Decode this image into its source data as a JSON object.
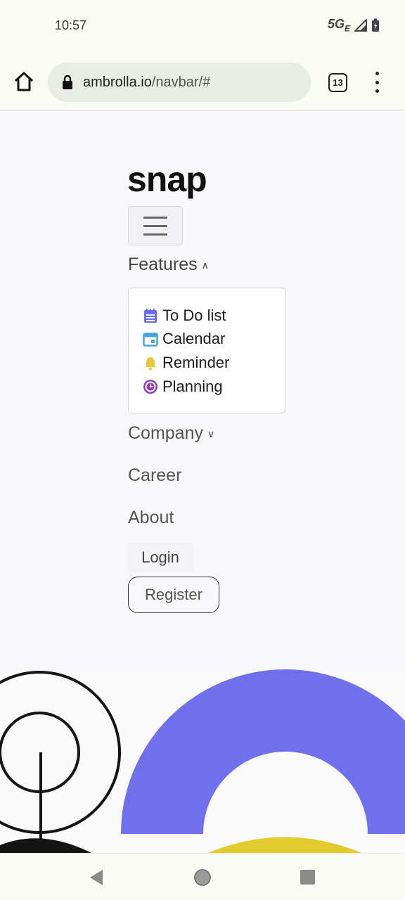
{
  "status_bar": {
    "time": "10:57",
    "network": "5G",
    "network_sub": "E"
  },
  "browser": {
    "url_domain": "ambrolla.io",
    "url_path": "/navbar/#",
    "tab_count": "13"
  },
  "page": {
    "logo": "snap",
    "nav": {
      "features": "Features",
      "features_items": [
        {
          "label": "To Do list",
          "icon": "todo-list-icon",
          "color": "#6c6ee8"
        },
        {
          "label": "Calendar",
          "icon": "calendar-icon",
          "color": "#4aa3d8"
        },
        {
          "label": "Reminder",
          "icon": "bell-icon",
          "color": "#e8c93a"
        },
        {
          "label": "Planning",
          "icon": "clock-icon",
          "color": "#8b3fb3"
        }
      ],
      "company": "Company",
      "career": "Career",
      "about": "About"
    },
    "login": "Login",
    "register": "Register"
  },
  "colors": {
    "accent_purple": "#7070ec",
    "accent_yellow": "#e2cb2c",
    "dark": "#141414"
  }
}
